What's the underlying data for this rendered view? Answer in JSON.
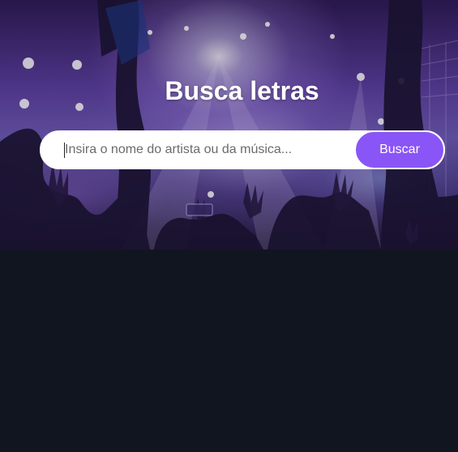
{
  "header": {
    "title": "Busca letras",
    "background_image": "concert-crowd-purple-lights"
  },
  "search": {
    "placeholder": "Insira o nome do artista ou da música...",
    "value": "",
    "button_label": "Buscar"
  },
  "colors": {
    "accent": "#8a55f6",
    "page_background": "#111520",
    "title_text": "#ffffff",
    "input_background": "#ffffff"
  }
}
